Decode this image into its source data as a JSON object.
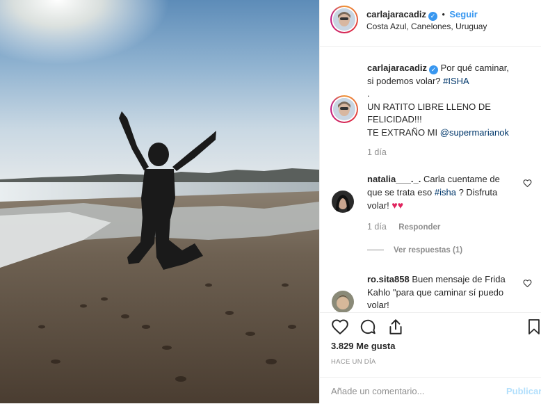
{
  "post": {
    "author": "carlajaracadiz",
    "follow_label": "Seguir",
    "location": "Costa Azul, Canelones, Uruguay",
    "caption_line1": "Por qué caminar, si podemos volar?",
    "caption_tag": "#ISHA",
    "caption_dot": ".",
    "caption_line2": "UN RATITO LIBRE LLENO DE FELICIDAD!!!",
    "caption_line3_prefix": "TE EXTRAÑO MI",
    "caption_mention": "@supermarianok",
    "caption_time": "1 día"
  },
  "comments": [
    {
      "user": "natalia___._.",
      "text_prefix": "Carla cuentame de que se trata eso",
      "text_tag": "#isha",
      "text_suffix": "? Disfruta volar!",
      "emoji": "♥♥",
      "time": "1 día",
      "reply_label": "Responder",
      "view_replies": "Ver respuestas (1)"
    },
    {
      "user": "ro.sita858",
      "text": "Buen mensaje de Frida Kahlo \"para que caminar sí puedo volar!"
    }
  ],
  "actions": {
    "likes": "3.829 Me gusta",
    "time_ago": "HACE UN DÍA",
    "comment_placeholder": "Añade un comentario...",
    "publish_label": "Publicar"
  },
  "colors": {
    "accent": "#3897f0",
    "link": "#00376b",
    "muted": "#8e8e8e",
    "heart": "#ed4956"
  },
  "icons": [
    "heart-icon",
    "comment-icon",
    "share-icon",
    "bookmark-icon",
    "verified-badge-icon"
  ]
}
